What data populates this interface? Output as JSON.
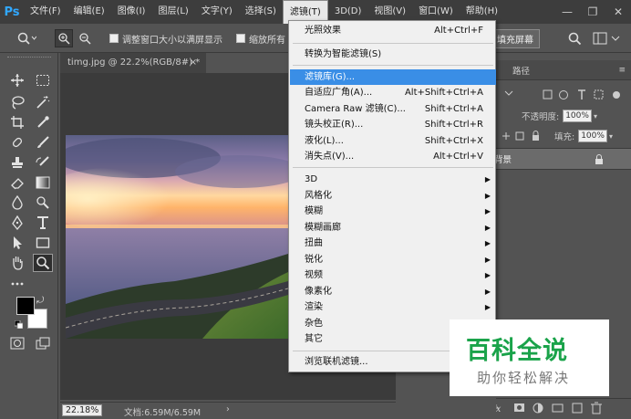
{
  "app": {
    "logo": "Ps"
  },
  "menubar": {
    "items": [
      "文件(F)",
      "编辑(E)",
      "图像(I)",
      "图层(L)",
      "文字(Y)",
      "选择(S)",
      "滤镜(T)",
      "3D(D)",
      "视图(V)",
      "窗口(W)",
      "帮助(H)"
    ],
    "active_index": 6
  },
  "window_controls": {
    "minimize": "—",
    "restore": "❐",
    "close": "✕"
  },
  "options_bar": {
    "resize_windows_label": "调整窗口大小以满屏显示",
    "zoom_all_label": "缩放所有",
    "fill_screen_label": "填充屏幕"
  },
  "document": {
    "tab_title": "timg.jpg @ 22.2%(RGB/8#) *",
    "tab_close": "×",
    "zoom_level": "22.18%",
    "doc_size": "文档:6.59M/6.59M",
    "status_arrow": "›"
  },
  "right_panel": {
    "tab_paths": "路径",
    "opacity_label": "不透明度:",
    "opacity_value": "100%",
    "fill_label": "填充:",
    "fill_value": "100%",
    "layer_name": "背景"
  },
  "filter_menu": {
    "items": [
      {
        "label": "光照效果",
        "shortcut": "Alt+Ctrl+F"
      },
      {
        "label": "转换为智能滤镜(S)",
        "shortcut": ""
      },
      {
        "label": "滤镜库(G)...",
        "shortcut": ""
      },
      {
        "label": "自适应广角(A)...",
        "shortcut": "Alt+Shift+Ctrl+A"
      },
      {
        "label": "Camera Raw 滤镜(C)...",
        "shortcut": "Shift+Ctrl+A"
      },
      {
        "label": "镜头校正(R)...",
        "shortcut": "Shift+Ctrl+R"
      },
      {
        "label": "液化(L)...",
        "shortcut": "Shift+Ctrl+X"
      },
      {
        "label": "消失点(V)...",
        "shortcut": "Alt+Ctrl+V"
      },
      {
        "label": "3D",
        "shortcut": ""
      },
      {
        "label": "风格化",
        "shortcut": ""
      },
      {
        "label": "模糊",
        "shortcut": ""
      },
      {
        "label": "模糊画廊",
        "shortcut": ""
      },
      {
        "label": "扭曲",
        "shortcut": ""
      },
      {
        "label": "锐化",
        "shortcut": ""
      },
      {
        "label": "视频",
        "shortcut": ""
      },
      {
        "label": "像素化",
        "shortcut": ""
      },
      {
        "label": "渲染",
        "shortcut": ""
      },
      {
        "label": "杂色",
        "shortcut": ""
      },
      {
        "label": "其它",
        "shortcut": ""
      },
      {
        "label": "浏览联机滤镜...",
        "shortcut": ""
      }
    ],
    "highlighted_index": 2,
    "submenu_arrow": "▶"
  },
  "watermark": {
    "title": "百科全说",
    "subtitle": "助你轻松解决"
  },
  "colors": {
    "menubar_bg": "#3d3d3d",
    "workspace_bg": "#535353",
    "menu_highlight": "#3a8ee6",
    "watermark_green": "#1aa34a",
    "ps_blue": "#31a8ff"
  }
}
